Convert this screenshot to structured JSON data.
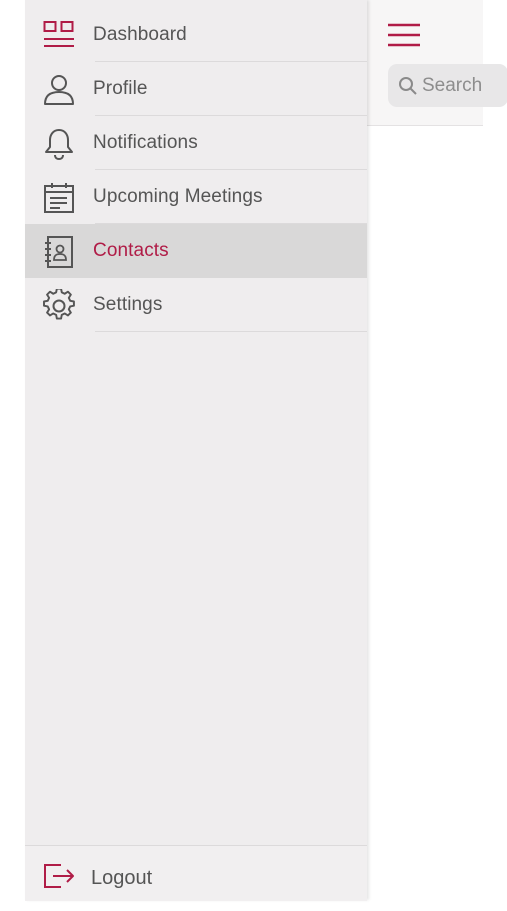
{
  "colors": {
    "accent": "#b01c47",
    "drawer_bg": "#efedee",
    "active_row": "#d9d8d8",
    "text": "#555555"
  },
  "drawer": {
    "items": [
      {
        "label": "Dashboard",
        "icon": "dashboard-icon",
        "active": false
      },
      {
        "label": "Profile",
        "icon": "profile-icon",
        "active": false
      },
      {
        "label": "Notifications",
        "icon": "bell-icon",
        "active": false
      },
      {
        "label": "Upcoming Meetings",
        "icon": "calendar-icon",
        "active": false
      },
      {
        "label": "Contacts",
        "icon": "contacts-book-icon",
        "active": true
      },
      {
        "label": "Settings",
        "icon": "gear-icon",
        "active": false
      }
    ],
    "logout": {
      "label": "Logout",
      "icon": "logout-icon"
    }
  },
  "main": {
    "menu_icon": "hamburger-icon",
    "search": {
      "placeholder": "Search",
      "icon": "search-icon"
    }
  }
}
